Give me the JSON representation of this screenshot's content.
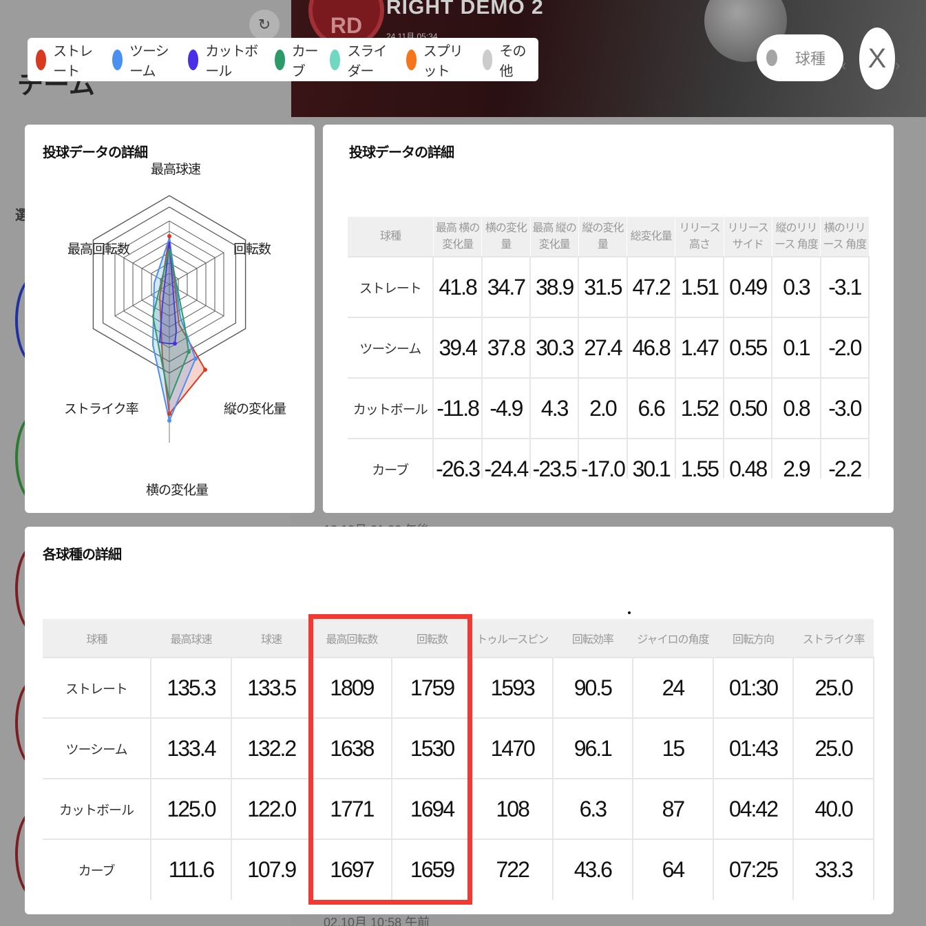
{
  "background": {
    "team_heading": "チーム",
    "select_tab": "選",
    "hero_title": "RIGHT DEMO 2",
    "hero_avatar": "RD",
    "hero_date": "24.11月 05:34",
    "refresh_icon": "↻"
  },
  "legend": [
    {
      "label": "ストレート",
      "color": "#d73a1e"
    },
    {
      "label": "ツーシーム",
      "color": "#4a90f0"
    },
    {
      "label": "カットボール",
      "color": "#4a2ee8"
    },
    {
      "label": "カーブ",
      "color": "#2e9a6a"
    },
    {
      "label": "スライダー",
      "color": "#6fd8c0"
    },
    {
      "label": "スプリット",
      "color": "#f5751a"
    },
    {
      "label": "その他",
      "color": "#cccccc"
    }
  ],
  "filter_pill": {
    "label": "球種"
  },
  "close_label": "X",
  "radar_card": {
    "title": "投球データの詳細",
    "axes": [
      "最高球速",
      "回転数",
      "縦の変化量",
      "横の変化量",
      "ストライク率",
      "最高回転数"
    ]
  },
  "pitch_table": {
    "title": "投球データの詳細",
    "headers": [
      "球種",
      "最高 横の 変化量",
      "横の変化量",
      "最高 縦の 変化量",
      "縦の変化量",
      "総変化量",
      "リリース高さ",
      "リリース サイド",
      "縦のリリース 角度",
      "横のリリース 角度"
    ],
    "rows": [
      [
        "ストレート",
        "41.8",
        "34.7",
        "38.9",
        "31.5",
        "47.2",
        "1.51",
        "0.49",
        "0.3",
        "-3.1"
      ],
      [
        "ツーシーム",
        "39.4",
        "37.8",
        "30.3",
        "27.4",
        "46.8",
        "1.47",
        "0.55",
        "0.1",
        "-2.0"
      ],
      [
        "カットボール",
        "-11.8",
        "-4.9",
        "4.3",
        "2.0",
        "6.6",
        "1.52",
        "0.50",
        "0.8",
        "-3.0"
      ],
      [
        "カーブ",
        "-26.3",
        "-24.4",
        "-23.5",
        "-17.0",
        "30.1",
        "1.55",
        "0.48",
        "2.9",
        "-2.2"
      ]
    ]
  },
  "detail_table": {
    "title": "各球種の詳細",
    "headers": [
      "球種",
      "最高球速",
      "球速",
      "最高回転数",
      "回転数",
      "トゥルースピン",
      "回転効率",
      "ジャイロの角度",
      "回転方向",
      "ストライク率"
    ],
    "rows": [
      [
        "ストレート",
        "135.3",
        "133.5",
        "1809",
        "1759",
        "1593",
        "90.5",
        "24",
        "01:30",
        "25.0"
      ],
      [
        "ツーシーム",
        "133.4",
        "132.2",
        "1638",
        "1530",
        "1470",
        "96.1",
        "15",
        "01:43",
        "25.0"
      ],
      [
        "カットボール",
        "125.0",
        "122.0",
        "1771",
        "1694",
        "108",
        "6.3",
        "87",
        "04:42",
        "40.0"
      ],
      [
        "カーブ",
        "111.6",
        "107.9",
        "1697",
        "1659",
        "722",
        "43.6",
        "64",
        "07:25",
        "33.3"
      ]
    ]
  },
  "bg_rows": [
    "12.10月 01:32 午後",
    "02.10月 10:58 午前"
  ]
}
